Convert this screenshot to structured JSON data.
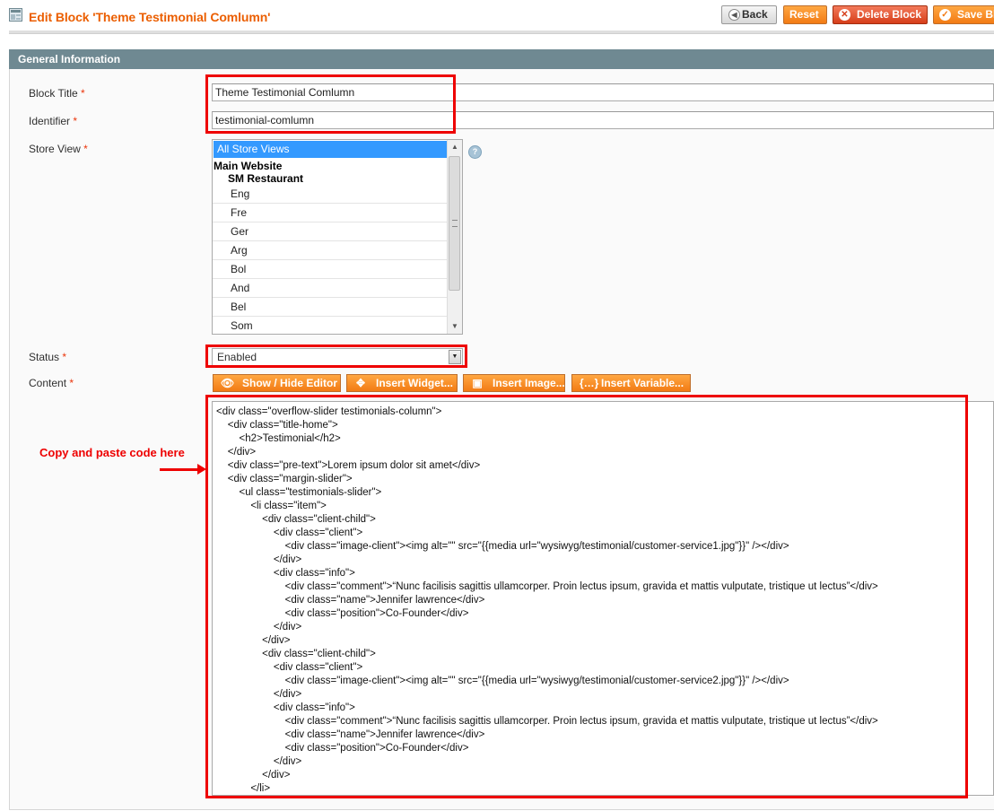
{
  "header": {
    "title": "Edit Block 'Theme Testimonial Comlumn'",
    "buttons": {
      "back": "Back",
      "reset": "Reset",
      "delete": "Delete Block",
      "save": "Save Bl"
    }
  },
  "fieldset": {
    "title": "General Information"
  },
  "form": {
    "required_mark": "*",
    "block_title": {
      "label": "Block Title",
      "value": "Theme Testimonial Comlumn"
    },
    "identifier": {
      "label": "Identifier",
      "value": "testimonial-comlumn"
    },
    "store_view": {
      "label": "Store View",
      "selected": "All Store Views",
      "group": "Main Website",
      "subgroup": "SM Restaurant",
      "options": [
        "Eng",
        "Fre",
        "Ger",
        "Arg",
        "Bol",
        "And",
        "Bel",
        "Som"
      ],
      "help": "?"
    },
    "status": {
      "label": "Status",
      "value": "Enabled"
    },
    "content": {
      "label": "Content",
      "buttons": {
        "show_hide": "Show / Hide Editor",
        "insert_widget": "Insert Widget...",
        "insert_image": "Insert Image...",
        "insert_variable": "Insert Variable..."
      },
      "code_lines": [
        "<div class=\"overflow-slider testimonials-column\">",
        "    <div class=\"title-home\">",
        "        <h2>Testimonial</h2>",
        "    </div>",
        "    <div class=\"pre-text\">Lorem ipsum dolor sit amet</div>",
        "    <div class=\"margin-slider\">",
        "        <ul class=\"testimonials-slider\">",
        "            <li class=\"item\">",
        "                <div class=\"client-child\">",
        "                    <div class=\"client\">",
        "                        <div class=\"image-client\"><img alt=\"\" src=\"{{media url=\"wysiwyg/testimonial/customer-service1.jpg\"}}\" /></div>",
        "                    </div>",
        "                    <div class=\"info\">",
        "                        <div class=\"comment\">“Nunc facilisis sagittis ullamcorper. Proin lectus ipsum, gravida et mattis vulputate, tristique ut lectus”</div>",
        "                        <div class=\"name\">Jennifer lawrence</div>",
        "                        <div class=\"position\">Co-Founder</div>",
        "                    </div>",
        "                </div>",
        "                <div class=\"client-child\">",
        "                    <div class=\"client\">",
        "                        <div class=\"image-client\"><img alt=\"\" src=\"{{media url=\"wysiwyg/testimonial/customer-service2.jpg\"}}\" /></div>",
        "                    </div>",
        "                    <div class=\"info\">",
        "                        <div class=\"comment\">“Nunc facilisis sagittis ullamcorper. Proin lectus ipsum, gravida et mattis vulputate, tristique ut lectus”</div>",
        "                        <div class=\"name\">Jennifer lawrence</div>",
        "                        <div class=\"position\">Co-Founder</div>",
        "                    </div>",
        "                </div>",
        "            </li>"
      ]
    }
  },
  "annotation": {
    "note": "Copy and paste code here"
  },
  "colors": {
    "accent": "#eb5e00",
    "annotation_red": "#ee0000",
    "fieldset_header": "#6f8992",
    "selection": "#3399ff"
  }
}
